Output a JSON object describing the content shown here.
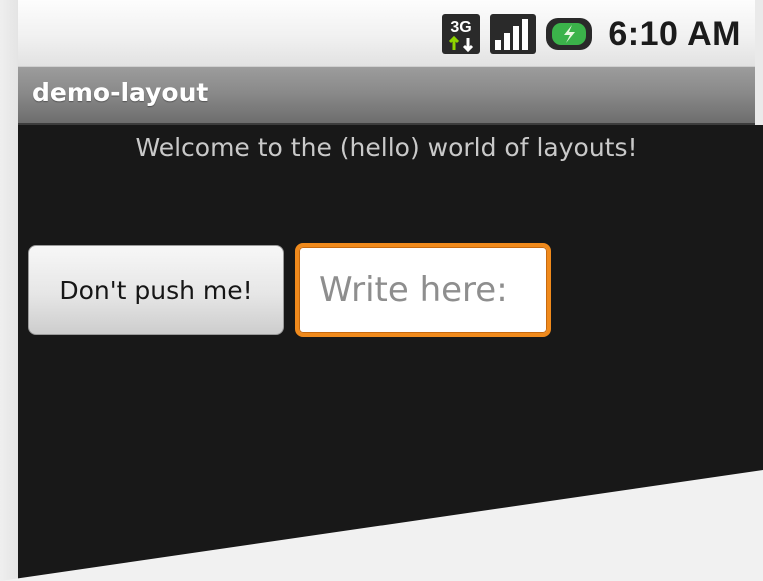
{
  "status_bar": {
    "network_type": "3G",
    "time": "6:10 AM",
    "icons": [
      "3g-data-icon",
      "signal-strength-icon",
      "battery-charging-icon"
    ]
  },
  "app": {
    "title": "demo-layout"
  },
  "main": {
    "welcome_text": "Welcome to the (hello) world of layouts!",
    "button_label": "Don't push me!",
    "input_placeholder": "Write here:",
    "input_value": ""
  },
  "colors": {
    "content_background": "#181818",
    "input_focus_border": "#f08a1c",
    "title_bar": "#8a8a8a"
  }
}
